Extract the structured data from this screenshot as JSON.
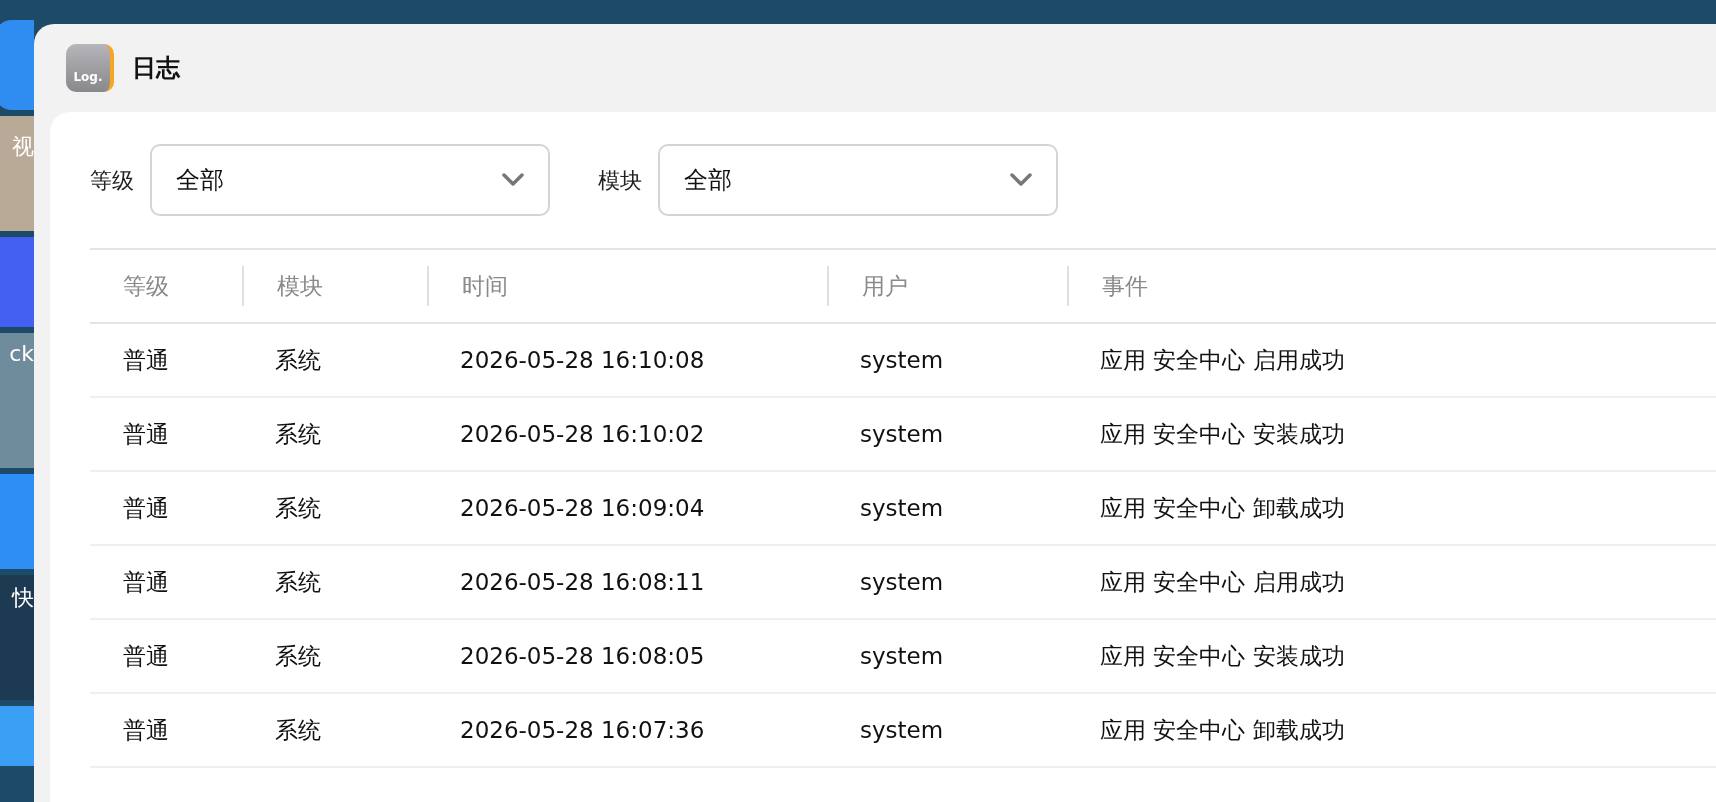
{
  "desktop": {
    "icons": [
      {
        "label": "视"
      },
      {
        "label": "ck"
      },
      {
        "label": "快"
      }
    ]
  },
  "window": {
    "title": "日志",
    "app_icon_text": "Log."
  },
  "filters": [
    {
      "label": "等级",
      "value": "全部"
    },
    {
      "label": "模块",
      "value": "全部"
    }
  ],
  "table": {
    "columns": [
      "等级",
      "模块",
      "时间",
      "用户",
      "事件"
    ],
    "rows": [
      [
        "普通",
        "系统",
        "2026-05-28 16:10:08",
        "system",
        "应用 安全中心 启用成功"
      ],
      [
        "普通",
        "系统",
        "2026-05-28 16:10:02",
        "system",
        "应用 安全中心 安装成功"
      ],
      [
        "普通",
        "系统",
        "2026-05-28 16:09:04",
        "system",
        "应用 安全中心 卸载成功"
      ],
      [
        "普通",
        "系统",
        "2026-05-28 16:08:11",
        "system",
        "应用 安全中心 启用成功"
      ],
      [
        "普通",
        "系统",
        "2026-05-28 16:08:05",
        "system",
        "应用 安全中心 安装成功"
      ],
      [
        "普通",
        "系统",
        "2026-05-28 16:07:36",
        "system",
        "应用 安全中心 卸载成功"
      ]
    ]
  }
}
